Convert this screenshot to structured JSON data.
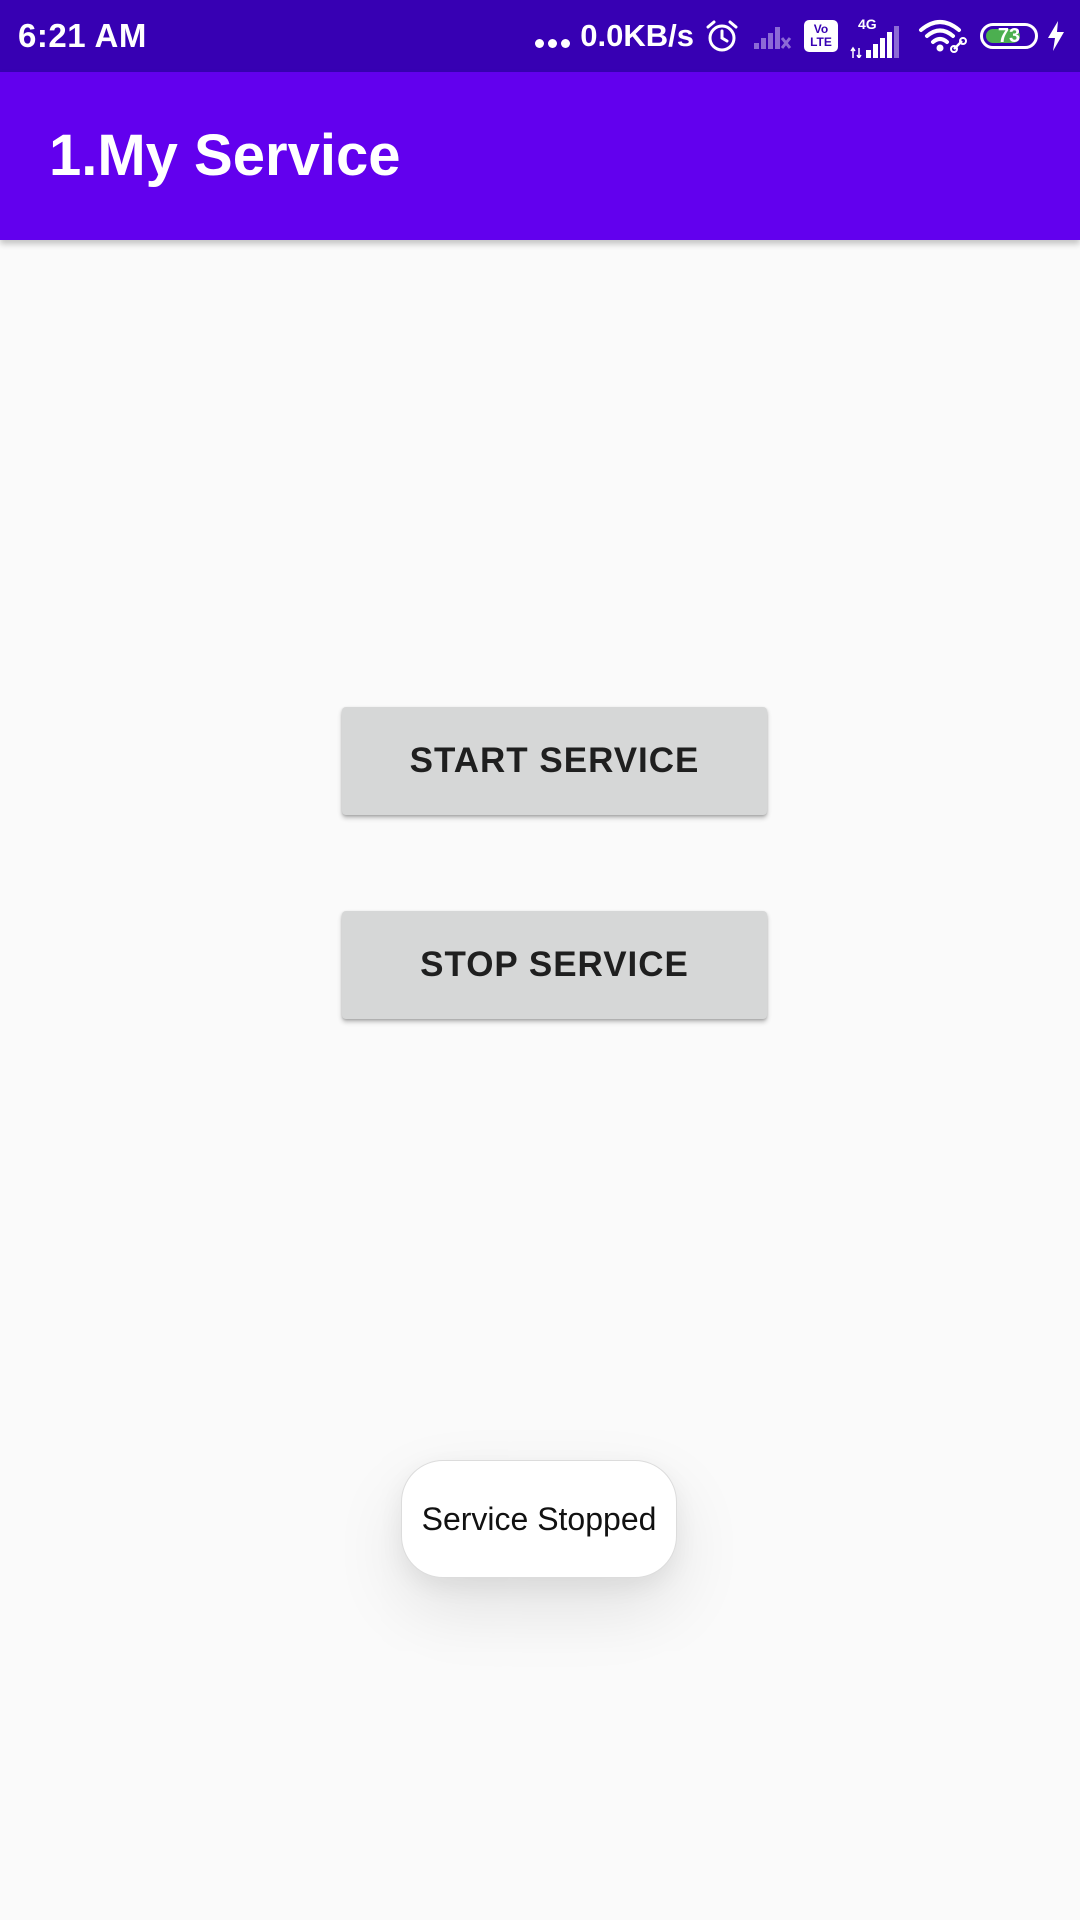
{
  "status_bar": {
    "time": "6:21 AM",
    "net_speed": "0.0KB/s",
    "volte_top": "Vo",
    "volte_bottom": "LTE",
    "network_type": "4G",
    "battery_level": "73",
    "battery_fraction": 0.73,
    "icons": [
      "more-dots-icon",
      "alarm-icon",
      "signal-no-service-icon",
      "volte-icon",
      "signal-4g-icon",
      "wifi-icon",
      "battery-icon",
      "charging-bolt-icon"
    ],
    "colors": {
      "background": "#3700b3",
      "battery_fill": "#4caf50"
    }
  },
  "app_bar": {
    "title": "1.My Service",
    "color": "#6200ee"
  },
  "buttons": {
    "start_label": "START SERVICE",
    "stop_label": "STOP SERVICE",
    "color": "#d6d7d7"
  },
  "toast": {
    "message": "Service Stopped"
  }
}
